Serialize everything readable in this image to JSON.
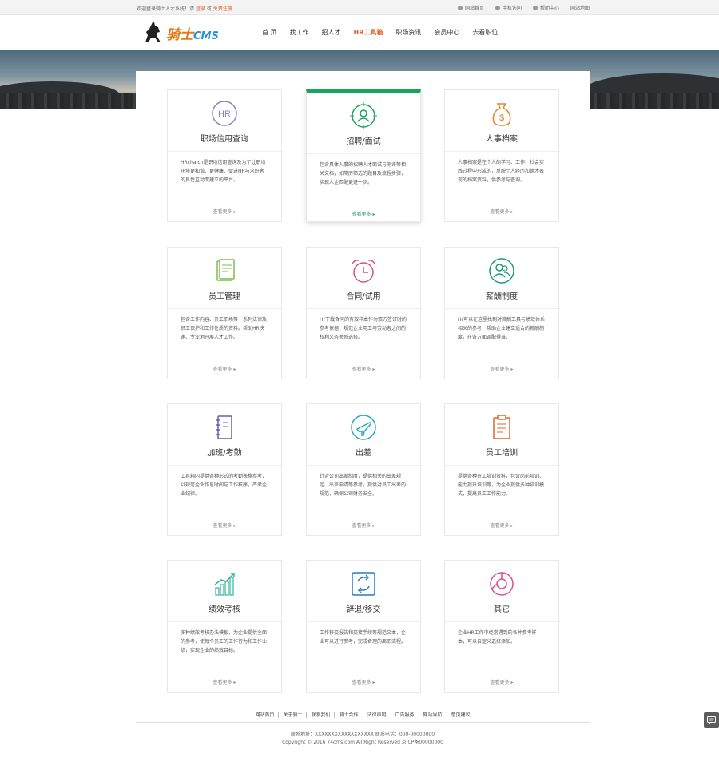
{
  "topbar": {
    "welcome": "欢迎登录骑士人才系统！请",
    "login": "登录",
    "or": "或",
    "register": "免费注册",
    "links": [
      "网站首页",
      "手机访问",
      "帮助中心",
      "网站地图"
    ]
  },
  "logo": {
    "text": "骑士",
    "sub": "CMS"
  },
  "nav": [
    "首 页",
    "找工作",
    "招人才",
    "HR工具箱",
    "职场资讯",
    "会员中心",
    "去看职位"
  ],
  "nav_active": "HR工具箱",
  "cards": [
    {
      "title": "职场信用查询",
      "icon": "hr-badge-icon",
      "color": "#8a7fd0",
      "desc": "HRcha.cn是职场信用查询及为了让职场环境更和谐、更健康、促进HR与求职者的良性互动而建立的平台。",
      "more": "查看更多"
    },
    {
      "title": "招聘/面试",
      "icon": "target-person-icon",
      "color": "#1aa35f",
      "desc": "包含具体入事的招聘人才面试与测评等相关文档，如简历筛选的题目及流程步骤，实现人企匹配更进一步。",
      "more": "查看更多"
    },
    {
      "title": "人事档案",
      "icon": "money-bag-icon",
      "color": "#e0862c",
      "desc": "人事档案是在个人的学习、工作、社会实践过程中形成的，反映个人经历和德才表现的档案资料，供参考与查询。",
      "more": "查看更多"
    },
    {
      "title": "员工管理",
      "icon": "document-icon",
      "color": "#7bbd4c",
      "desc": "包含工作内容、员工职场等一系列法律及员工保护和工作性质的资料。帮助HR快速、专业地开展人才工作。",
      "more": "查看更多"
    },
    {
      "title": "合同/试用",
      "icon": "alarm-clock-icon",
      "color": "#d3538a",
      "desc": "Hr下载合同的有效样本作为双方签订时的参考依据，规范企业用工与劳动者之间的权利义务关系选择。",
      "more": "查看更多"
    },
    {
      "title": "薪酬制度",
      "icon": "people-circle-icon",
      "color": "#1d9a7c",
      "desc": "Hr可以在这里找到对薪酬工具与绩效体系相关的参考，帮助企业建立适合的薪酬制度，在各方面调配得当。",
      "more": "查看更多"
    },
    {
      "title": "加班/考勤",
      "icon": "notebook-icon",
      "color": "#6a5ab8",
      "desc": "工具箱内提供各种形式的考勤表格参考，以规范企业作息时间与工作秩序，严肃企业纪律。",
      "more": "查看更多"
    },
    {
      "title": "出差",
      "icon": "airplane-icon",
      "color": "#27a7c8",
      "desc": "针对公司出差制度，提供相关的出差规定、出差申请等参考，提供对员工出差的规范，确保公司财务安全。",
      "more": "查看更多"
    },
    {
      "title": "员工培训",
      "icon": "clipboard-icon",
      "color": "#e0662c",
      "desc": "提供各种员工培训资料，包含岗前培训、能力提升培训等，为企业提供多种培训模式，提高员工工作能力。",
      "more": "查看更多"
    },
    {
      "title": "绩效考核",
      "icon": "bar-growth-icon",
      "color": "#2fb89a",
      "desc": "多种绩效考核办法模板，为企业提供全面的参考，使每个员工的工作行为和工作业绩，实现企业的绩效目标。",
      "more": "查看更多"
    },
    {
      "title": "辞退/移交",
      "icon": "exchange-icon",
      "color": "#2b7cc0",
      "desc": "工作移交报告和交接手续等规范文本，企业可以进行参考，完成合理的离职流程。",
      "more": "查看更多"
    },
    {
      "title": "其它",
      "icon": "pie-circle-icon",
      "color": "#d3538a",
      "desc": "企业HR工作中经常遇到的各种参考样本，可以自定义选择添加。",
      "more": "查看更多"
    }
  ],
  "footer": {
    "links": [
      "网站首页",
      "关于骑士",
      "联系我们",
      "骑士合作",
      "法律声明",
      "广告服务",
      "网站导航",
      "意见建议"
    ],
    "line1": "联系地址：XXXXXXXXXXXXXXXXXX  联系电话：000-00000000",
    "line2": "Copyright © 2016 74cms.com All Right Reserved 京ICP备00000000"
  }
}
